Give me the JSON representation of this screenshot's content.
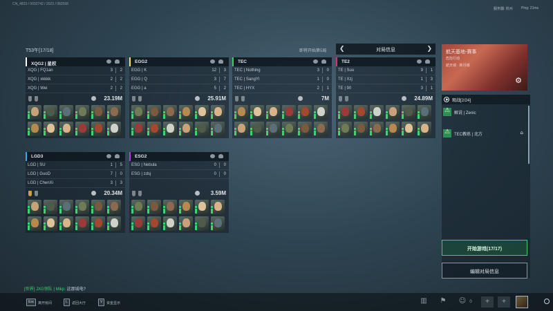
{
  "topbar": {
    "build": "CN_4823 / 0032742 / 2023 / 082568",
    "server": "服务器: 杭州",
    "ping": "Ping: 21ms"
  },
  "room": {
    "title": "T53午[17/18]",
    "countdown": "即将开始第5局"
  },
  "teams": [
    {
      "name": "XQG2 | 星权",
      "color": "#ffffff",
      "players": [
        {
          "name": "XQG | FQ1an",
          "k": "3",
          "d": "2"
        },
        {
          "name": "XQG | xkkkk",
          "k": "2",
          "d": "2"
        },
        {
          "name": "XQG | Wei",
          "k": "2",
          "d": "2"
        }
      ],
      "money": "23.19M",
      "gold_badge": false
    },
    {
      "name": "EGG2",
      "color": "#f0e55a",
      "players": [
        {
          "name": "EGG | K",
          "k": "12",
          "d": "3"
        },
        {
          "name": "EGG | Q",
          "k": "3",
          "d": "7"
        },
        {
          "name": "EGG | a",
          "k": "5",
          "d": "2"
        }
      ],
      "money": "25.91M",
      "gold_badge": false
    },
    {
      "name": "TEC",
      "color": "#3bd06a",
      "players": [
        {
          "name": "TEC | Nothing",
          "k": "3",
          "d": "0"
        },
        {
          "name": "TEC | SangYI",
          "k": "1",
          "d": "0"
        },
        {
          "name": "TEC | HYX",
          "k": "2",
          "d": "1"
        }
      ],
      "money": "7M",
      "gold_badge": false
    },
    {
      "name": "TE2",
      "color": "#d8336a",
      "players": [
        {
          "name": "TE | Suu",
          "k": "9",
          "d": "1"
        },
        {
          "name": "TE | Xzj",
          "k": "1",
          "d": "3"
        },
        {
          "name": "TE | 90",
          "k": "3",
          "d": "1"
        }
      ],
      "money": "24.89M",
      "gold_badge": false
    },
    {
      "name": "LGD3",
      "color": "#3aa7e0",
      "players": [
        {
          "name": "LGD | SU",
          "k": "1",
          "d": "5"
        },
        {
          "name": "LGD | GuoD",
          "k": "7",
          "d": "0"
        },
        {
          "name": "LGD | ChenXi",
          "k": "3",
          "d": "3"
        }
      ],
      "money": "20.34M",
      "gold_badge": true
    },
    {
      "name": "ESG2",
      "color": "#b23fd6",
      "players": [
        {
          "name": "ESG | Nebula",
          "k": "0",
          "d": "0"
        },
        {
          "name": "ESG | zdsj",
          "k": "0",
          "d": "0"
        }
      ],
      "money": "3.59M",
      "gold_badge": false
    }
  ],
  "match_info": {
    "title": "对局信息",
    "prev_icon": "chevron-left-icon",
    "next_icon": "chevron-right-icon"
  },
  "banner": {
    "title": "航天基地-赛事",
    "line1": "危险行动",
    "line2": "航天城 · 新月城"
  },
  "spectators": {
    "title": "观战[2/24]",
    "items": [
      {
        "name": "解说 | Zenic"
      },
      {
        "name": "TEC教练 | 北方"
      }
    ]
  },
  "buttons": {
    "start": "开始游戏(17/17)",
    "edit": "编辑对局信息"
  },
  "chat": {
    "channel": "[世界] JXG领队 | Mikp:",
    "message": "这那城电?"
  },
  "bottom": {
    "keys": [
      {
        "key": "Esc",
        "label": "离开房间"
      },
      {
        "key": "L",
        "label": "返回大厅"
      },
      {
        "key": "V",
        "label": "资金显示"
      }
    ],
    "players_count": "0"
  }
}
